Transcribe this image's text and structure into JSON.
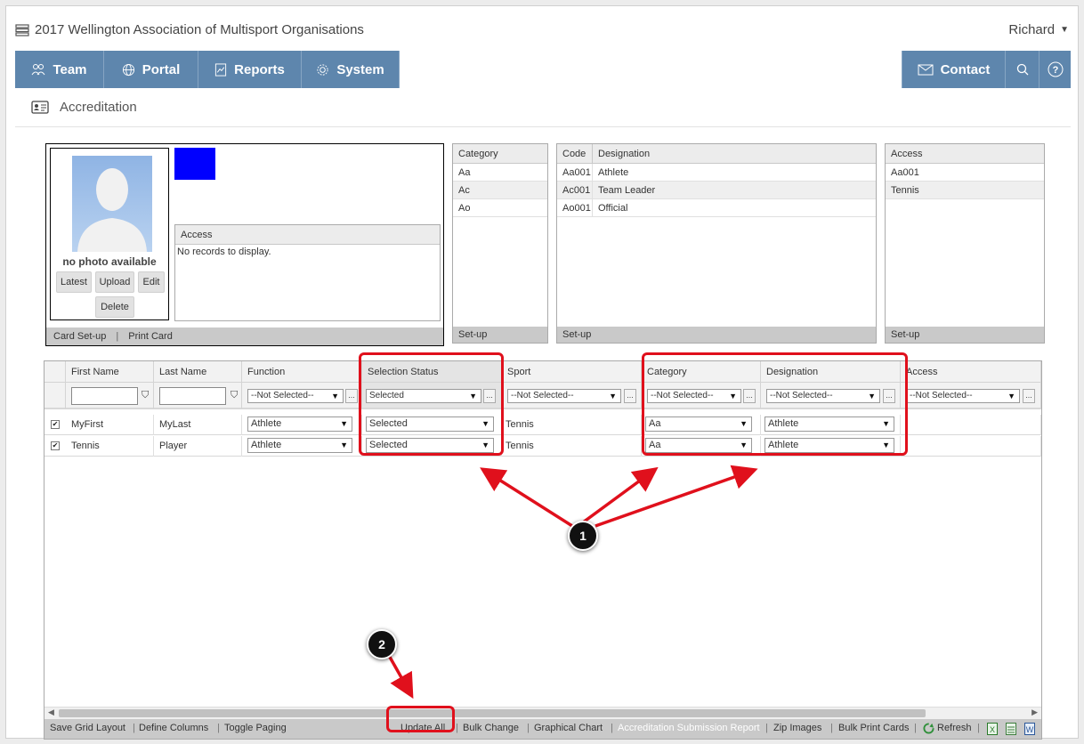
{
  "header": {
    "app_title": "2017 Wellington Association of Multisport Organisations",
    "user_name": "Richard"
  },
  "nav": {
    "team": "Team",
    "portal": "Portal",
    "reports": "Reports",
    "system": "System",
    "contact": "Contact"
  },
  "page": {
    "title": "Accreditation"
  },
  "photo": {
    "placeholder": "no photo available",
    "latest": "Latest",
    "upload": "Upload",
    "edit": "Edit",
    "delete": "Delete",
    "color_swatch": "#0000ff"
  },
  "access_panel": {
    "header": "Access",
    "empty": "No records to display."
  },
  "card_links": {
    "card_setup": "Card Set-up",
    "print_card": "Print Card"
  },
  "category_panel": {
    "header": "Category",
    "rows": [
      "Aa",
      "Ac",
      "Ao"
    ],
    "footer": "Set-up"
  },
  "designation_panel": {
    "header_code": "Code",
    "header_designation": "Designation",
    "rows": [
      {
        "code": "Aa001",
        "designation": "Athlete"
      },
      {
        "code": "Ac001",
        "designation": "Team Leader"
      },
      {
        "code": "Ao001",
        "designation": "Official"
      }
    ],
    "footer": "Set-up"
  },
  "access_list_panel": {
    "header": "Access",
    "rows": [
      "Aa001",
      "Tennis"
    ],
    "footer": "Set-up"
  },
  "grid": {
    "columns": {
      "first_name": "First Name",
      "last_name": "Last Name",
      "function": "Function",
      "selection_status": "Selection Status",
      "sport": "Sport",
      "category": "Category",
      "designation": "Designation",
      "access": "Access"
    },
    "filters": {
      "function": "--Not Selected--",
      "selection_status": "Selected",
      "sport": "--Not Selected--",
      "category": "--Not Selected--",
      "designation": "--Not Selected--",
      "access": "--Not Selected--",
      "more": "..."
    },
    "rows": [
      {
        "checked": "✔",
        "first_name": "MyFirst",
        "last_name": "MyLast",
        "function": "Athlete",
        "selection_status": "Selected",
        "sport": "Tennis",
        "category": "Aa",
        "designation": "Athlete"
      },
      {
        "checked": "✔",
        "first_name": "Tennis",
        "last_name": "Player",
        "function": "Athlete",
        "selection_status": "Selected",
        "sport": "Tennis",
        "category": "Aa",
        "designation": "Athlete"
      }
    ]
  },
  "toolbar": {
    "save_grid_layout": "Save Grid Layout",
    "define_columns": "Define Columns",
    "toggle_paging": "Toggle Paging",
    "update_all": "Update All",
    "bulk_change": "Bulk Change",
    "graphical_chart": "Graphical Chart",
    "accreditation_submission_report": "Accreditation Submission Report",
    "zip_images": "Zip Images",
    "bulk_print_cards": "Bulk Print Cards",
    "refresh": "Refresh",
    "separator": "|"
  },
  "annotations": {
    "marker_1": "1",
    "marker_2": "2",
    "color": "#e0101c"
  }
}
